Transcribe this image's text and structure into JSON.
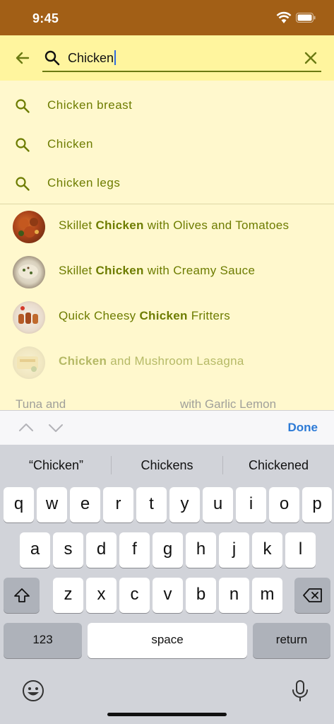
{
  "status": {
    "time": "9:45"
  },
  "search": {
    "query": "Chicken"
  },
  "suggestions": [
    {
      "label": "Chicken breast"
    },
    {
      "label": "Chicken"
    },
    {
      "label": "Chicken legs"
    }
  ],
  "recipes": [
    {
      "before": "Skillet ",
      "match": "Chicken",
      "after": " with Olives and Tomatoes"
    },
    {
      "before": "Skillet ",
      "match": "Chicken",
      "after": " with Creamy Sauce"
    },
    {
      "before": "Quick Cheesy ",
      "match": "Chicken",
      "after": " Fritters"
    },
    {
      "before": "",
      "match": "Chicken",
      "after": " and Mushroom Lasagna"
    }
  ],
  "peek_text": {
    "left": "Tuna and",
    "right": "with Garlic Lemon"
  },
  "accessory": {
    "done": "Done"
  },
  "predictions": [
    "“Chicken”",
    "Chickens",
    "Chickened"
  ],
  "keyboard": {
    "row1": [
      "q",
      "w",
      "e",
      "r",
      "t",
      "y",
      "u",
      "i",
      "o",
      "p"
    ],
    "row2": [
      "a",
      "s",
      "d",
      "f",
      "g",
      "h",
      "j",
      "k",
      "l"
    ],
    "row3": [
      "z",
      "x",
      "c",
      "v",
      "b",
      "n",
      "m"
    ],
    "numbers": "123",
    "space": "space",
    "return": "return"
  },
  "colors": {
    "status_bar": "#a25f16",
    "search_bar": "#fff59e",
    "results_bg": "#fff8cd",
    "accent_text": "#6d7c00",
    "done": "#2c7ad6"
  }
}
